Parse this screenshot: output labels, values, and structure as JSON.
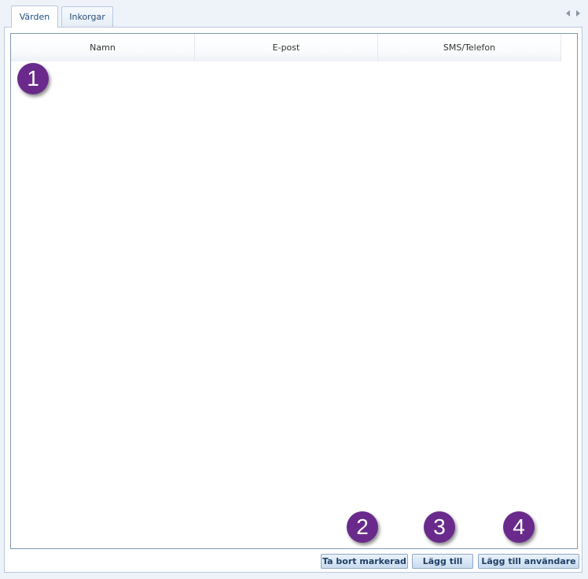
{
  "tabs": [
    {
      "label": "Värden",
      "active": true
    },
    {
      "label": "Inkorgar",
      "active": false
    }
  ],
  "grid": {
    "columns": [
      "Namn",
      "E-post",
      "SMS/Telefon"
    ],
    "rows": []
  },
  "buttons": {
    "remove_selected": "Ta bort markerad",
    "add": "Lägg till",
    "add_user": "Lägg till användare"
  },
  "callouts": [
    "1",
    "2",
    "3",
    "4"
  ],
  "colors": {
    "callout": "#6a2a8c",
    "border": "#7f98b4",
    "tab_text": "#2c4f7a"
  }
}
